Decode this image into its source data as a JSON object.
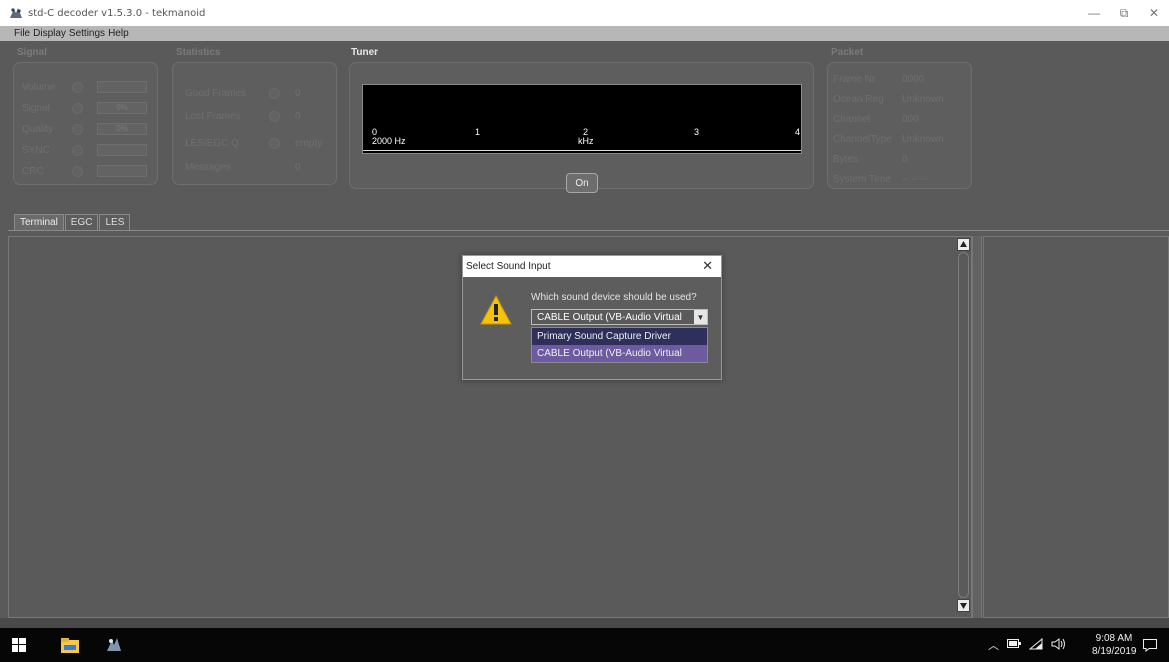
{
  "window": {
    "title": "std-C decoder v1.5.3.0 - tekmanoid",
    "minimize_glyph": "—",
    "restore_glyph": "⧉",
    "close_glyph": "✕"
  },
  "menu": {
    "items": [
      "File",
      "Display",
      "Settings",
      "Help"
    ]
  },
  "signal": {
    "title": "Signal",
    "rows": [
      {
        "label": "Volume"
      },
      {
        "label": "Signal",
        "value": "0%"
      },
      {
        "label": "Quality",
        "value": "0%"
      },
      {
        "label": "SYNC"
      },
      {
        "label": "CRC"
      }
    ]
  },
  "statistics": {
    "title": "Statistics",
    "rows": [
      {
        "label": "Good Frames",
        "value": "0"
      },
      {
        "label": "Lost Frames",
        "value": "0"
      },
      {
        "label": "LES/EGC Q",
        "value": "empty"
      },
      {
        "label": "Messages",
        "value": "0"
      }
    ]
  },
  "tuner": {
    "title": "Tuner",
    "ticks": [
      "0",
      "1",
      "2",
      "3",
      "4"
    ],
    "freq_label": "2000 Hz",
    "unit_label": "kHz",
    "on_button": "On"
  },
  "packet": {
    "title": "Packet",
    "rows": [
      {
        "label": "Frame Nr",
        "value": "0000"
      },
      {
        "label": "Ocean Reg",
        "value": "Unknown"
      },
      {
        "label": "Channel",
        "value": "000"
      },
      {
        "label": "ChannelType",
        "value": "Unknown"
      },
      {
        "label": "Bytes",
        "value": "0"
      },
      {
        "label": "System Time",
        "value": "-- -- --"
      }
    ]
  },
  "tabs": [
    "Terminal",
    "EGC",
    "LES"
  ],
  "dialog": {
    "title": "Select Sound Input",
    "close_glyph": "✕",
    "question": "Which sound device should be used?",
    "selected": "CABLE Output (VB-Audio Virtual",
    "options": [
      "Primary Sound Capture Driver",
      "CABLE Output (VB-Audio Virtual"
    ],
    "accent_color": "#f4c20d"
  },
  "taskbar": {
    "time": "9:08 AM",
    "date": "8/19/2019"
  }
}
